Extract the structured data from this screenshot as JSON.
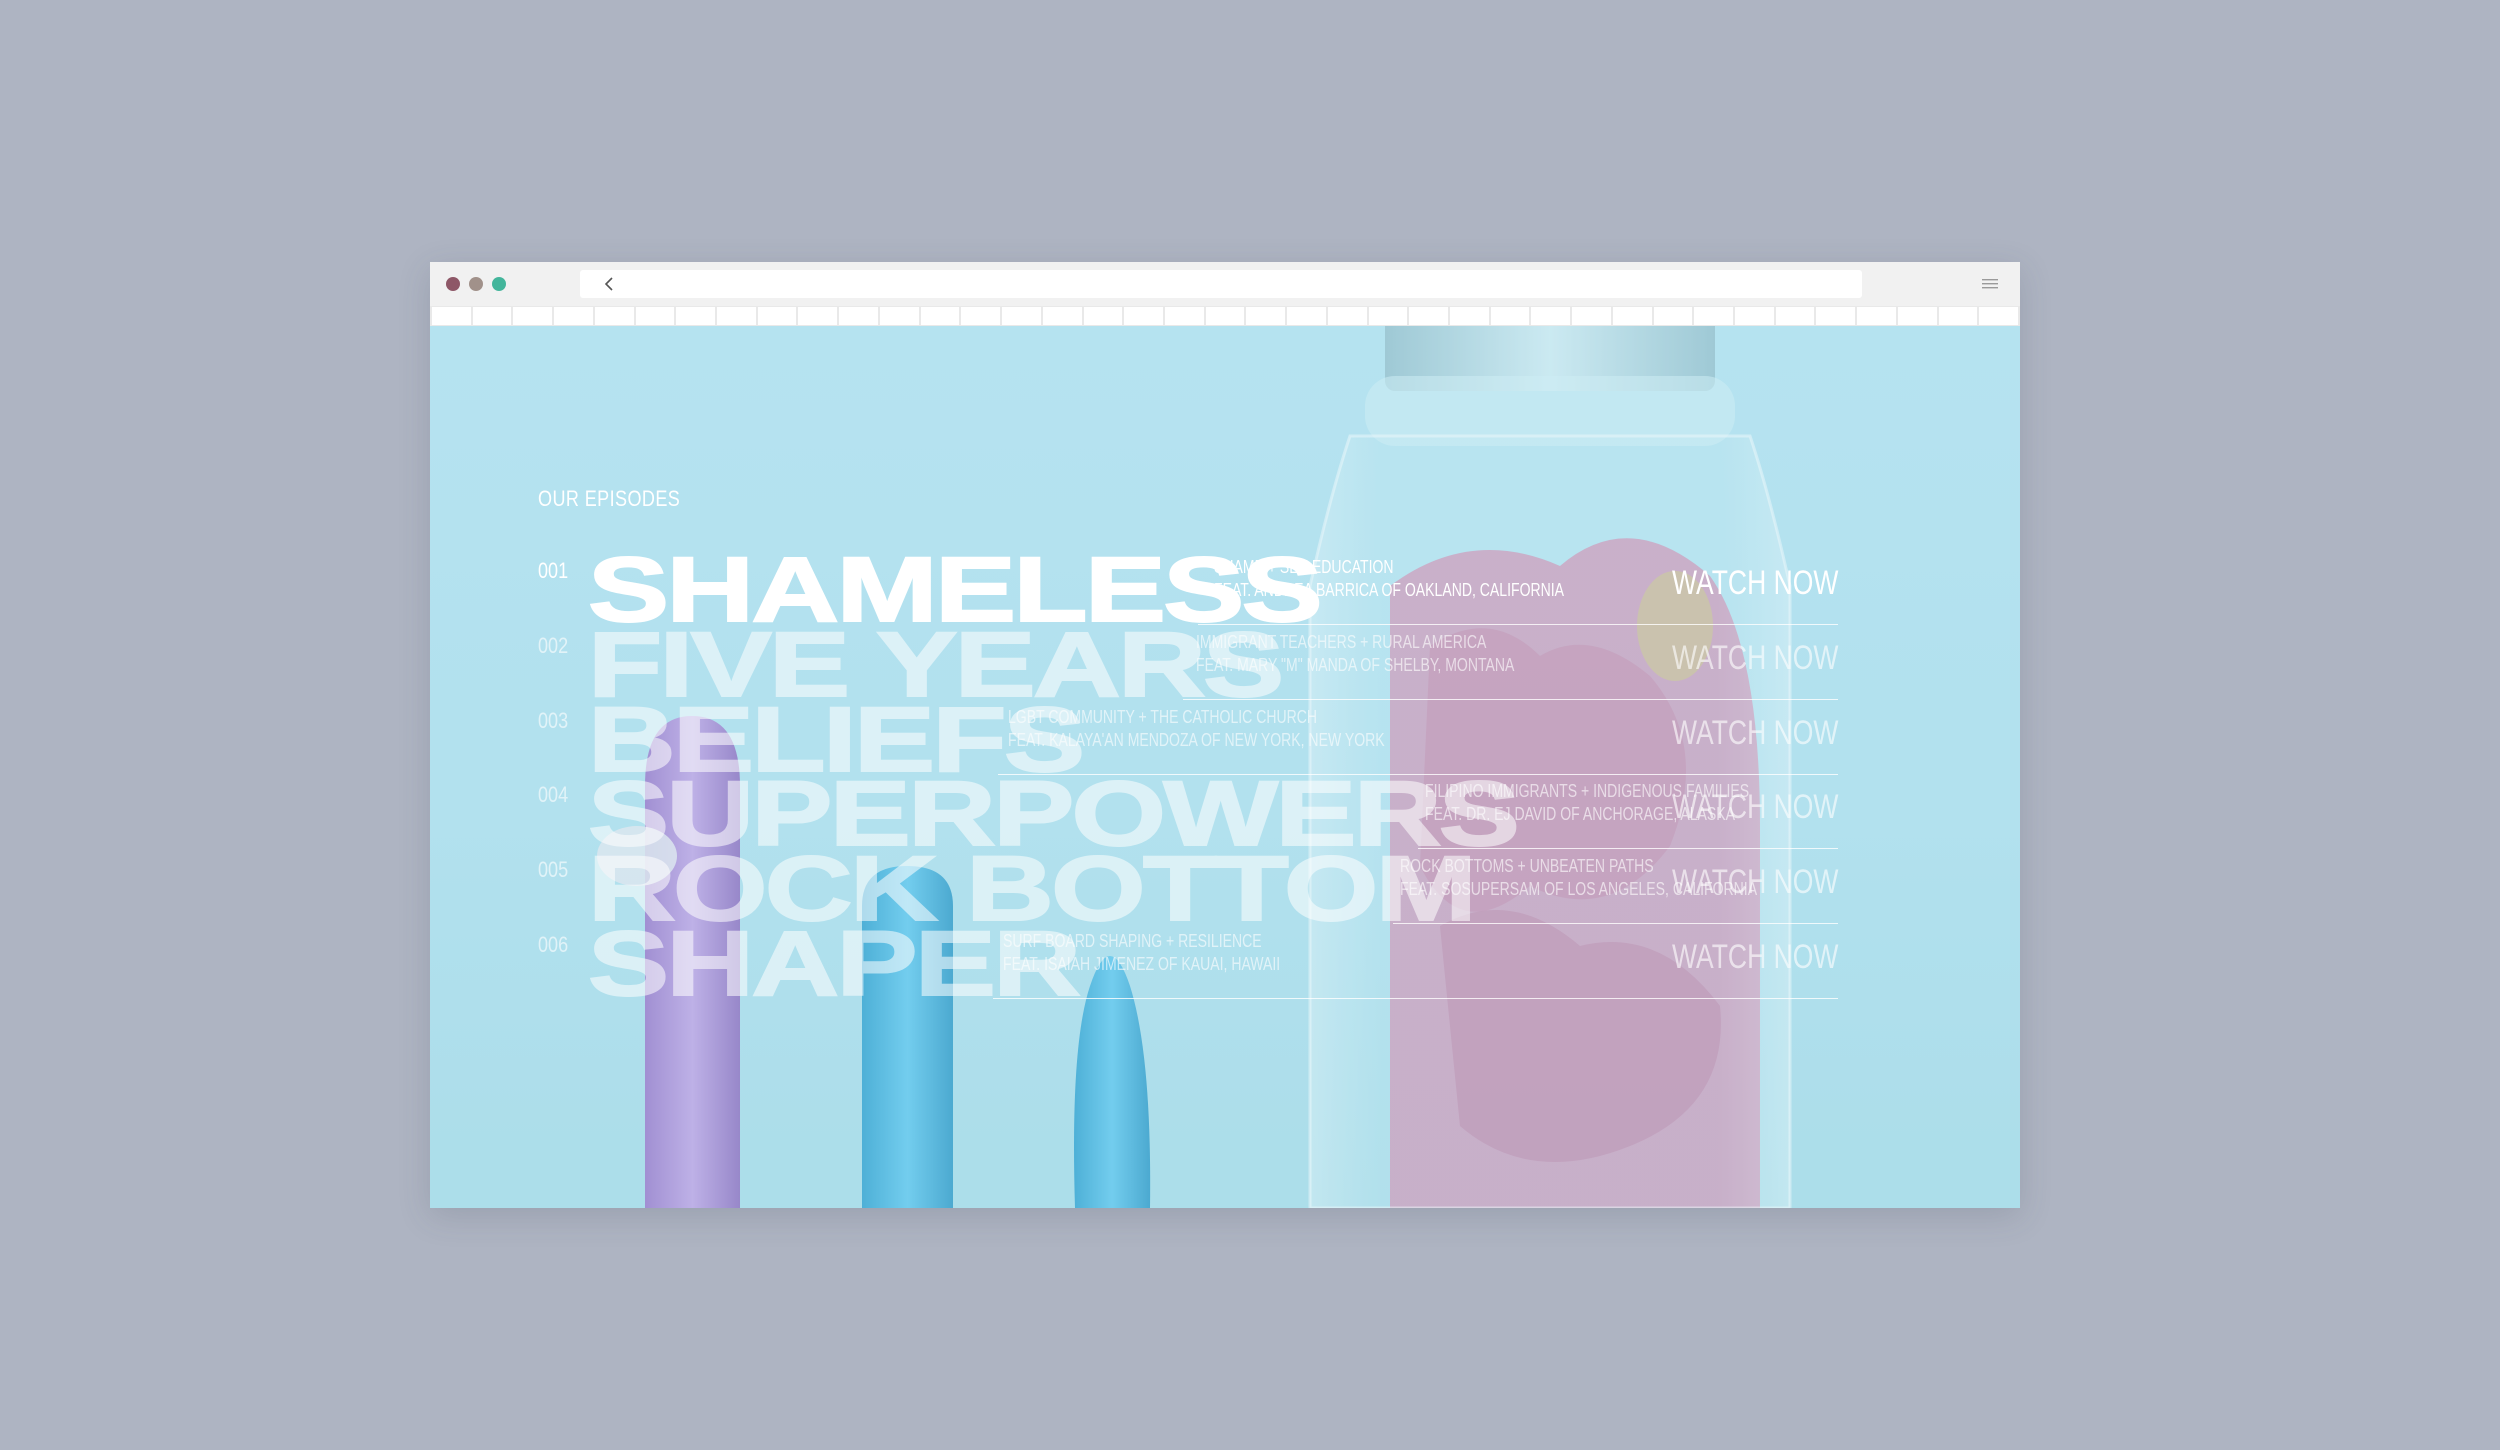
{
  "browser": {
    "url": ""
  },
  "section": {
    "label": "OUR EPISODES"
  },
  "episodes": [
    {
      "number": "001",
      "title": "SHAMELESS",
      "topic": "SHAME + SEX EDUCATION",
      "feature": "FEAT. ANDREA BARRICA OF OAKLAND, CALIFORNIA",
      "cta": "WATCH NOW"
    },
    {
      "number": "002",
      "title": "FIVE YEARS",
      "topic": "IMMIGRANT TEACHERS + RURAL AMERICA",
      "feature": "FEAT. MARY \"M\" MANDA OF SHELBY, MONTANA",
      "cta": "WATCH NOW"
    },
    {
      "number": "003",
      "title": "BELIEFS",
      "topic": "LGBT COMMUNITY + THE CATHOLIC CHURCH",
      "feature": "FEAT. KALAYA'AN MENDOZA OF NEW YORK, NEW YORK",
      "cta": "WATCH NOW"
    },
    {
      "number": "004",
      "title": "SUPERPOWERS",
      "topic": "FILIPINO IMMIGRANTS + INDIGENOUS FAMILIES",
      "feature": "FEAT. DR. EJ DAVID OF ANCHORAGE, ALASKA",
      "cta": "WATCH NOW"
    },
    {
      "number": "005",
      "title": "ROCK BOTTOM",
      "topic": "ROCK BOTTOMS + UNBEATEN PATHS",
      "feature": "FEAT. SOSUPERSAM OF LOS ANGELES, CALIFORNIA",
      "cta": "WATCH NOW"
    },
    {
      "number": "006",
      "title": "SHAPER",
      "topic": "SURF BOARD SHAPING + RESILIENCE",
      "feature": "FEAT. ISAIAH JIMENEZ OF KAUAI, HAWAII",
      "cta": "WATCH NOW"
    }
  ],
  "colors": {
    "page_bg": "#aeb4c2",
    "sky": "#b5e3f0",
    "pink": "#d47fa6",
    "purple": "#b08fd6",
    "blue": "#3fb1dd"
  },
  "icons": {
    "back": "chevron-left-icon",
    "menu": "hamburger-menu-icon"
  }
}
